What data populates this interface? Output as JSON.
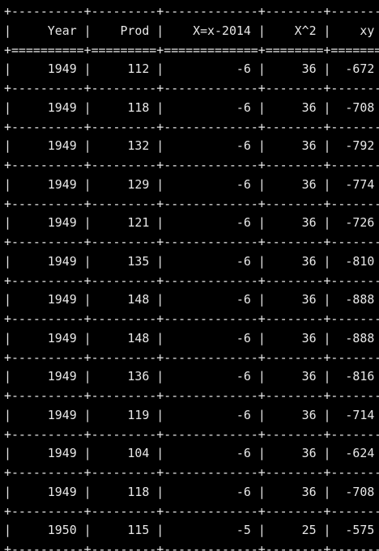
{
  "table": {
    "columns": [
      "Year",
      "Prod",
      "X=x-2014",
      "X^2",
      "xy"
    ],
    "rows": [
      [
        "1949",
        "112",
        "-6",
        "36",
        "-672"
      ],
      [
        "1949",
        "118",
        "-6",
        "36",
        "-708"
      ],
      [
        "1949",
        "132",
        "-6",
        "36",
        "-792"
      ],
      [
        "1949",
        "129",
        "-6",
        "36",
        "-774"
      ],
      [
        "1949",
        "121",
        "-6",
        "36",
        "-726"
      ],
      [
        "1949",
        "135",
        "-6",
        "36",
        "-810"
      ],
      [
        "1949",
        "148",
        "-6",
        "36",
        "-888"
      ],
      [
        "1949",
        "148",
        "-6",
        "36",
        "-888"
      ],
      [
        "1949",
        "136",
        "-6",
        "36",
        "-816"
      ],
      [
        "1949",
        "119",
        "-6",
        "36",
        "-714"
      ],
      [
        "1949",
        "104",
        "-6",
        "36",
        "-624"
      ],
      [
        "1949",
        "118",
        "-6",
        "36",
        "-708"
      ],
      [
        "1950",
        "115",
        "-5",
        "25",
        "-575"
      ]
    ]
  },
  "colors": {
    "background": "#000000",
    "text": "#e8e8e8"
  }
}
